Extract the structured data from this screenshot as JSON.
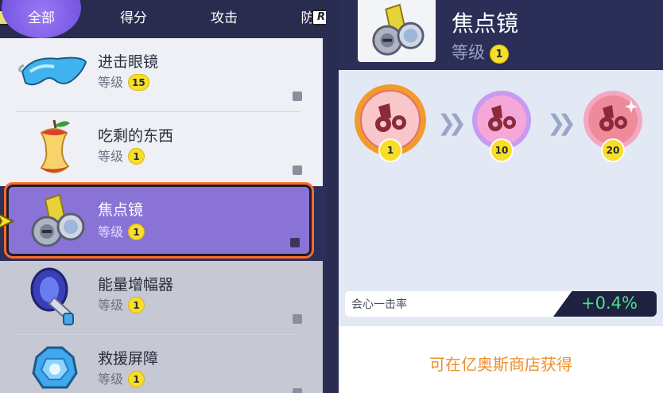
{
  "tabs": [
    {
      "label": "全部",
      "active": true
    },
    {
      "label": "得分",
      "active": false
    },
    {
      "label": "攻击",
      "active": false
    },
    {
      "label": "防",
      "active": false
    }
  ],
  "hints": {
    "left": "",
    "right": "R"
  },
  "items": [
    {
      "name": "进击眼镜",
      "level_label": "等级",
      "level": "15",
      "icon": "goggles-icon"
    },
    {
      "name": "吃剩的东西",
      "level_label": "等级",
      "level": "1",
      "icon": "apple-core-icon"
    },
    {
      "name": "焦点镜",
      "level_label": "等级",
      "level": "1",
      "icon": "scope-lens-icon"
    },
    {
      "name": "能量增幅器",
      "level_label": "等级",
      "level": "1",
      "icon": "energy-amplifier-icon"
    },
    {
      "name": "救援屏障",
      "level_label": "等级",
      "level": "1",
      "icon": "rescue-shield-icon"
    }
  ],
  "detail": {
    "title": "焦点镜",
    "level_label": "等级",
    "level": "1",
    "stages": [
      "1",
      "10",
      "20"
    ],
    "stat_label": "会心一击率",
    "stat_value": "+0.4%",
    "footer": "可在亿奥斯商店获得"
  },
  "colors": {
    "accent": "#7d5de6",
    "selected_outline": "#ff6a2a",
    "badge": "#f7de2a",
    "stat_value": "#4ee08a",
    "footer_text": "#ef8f2c"
  }
}
